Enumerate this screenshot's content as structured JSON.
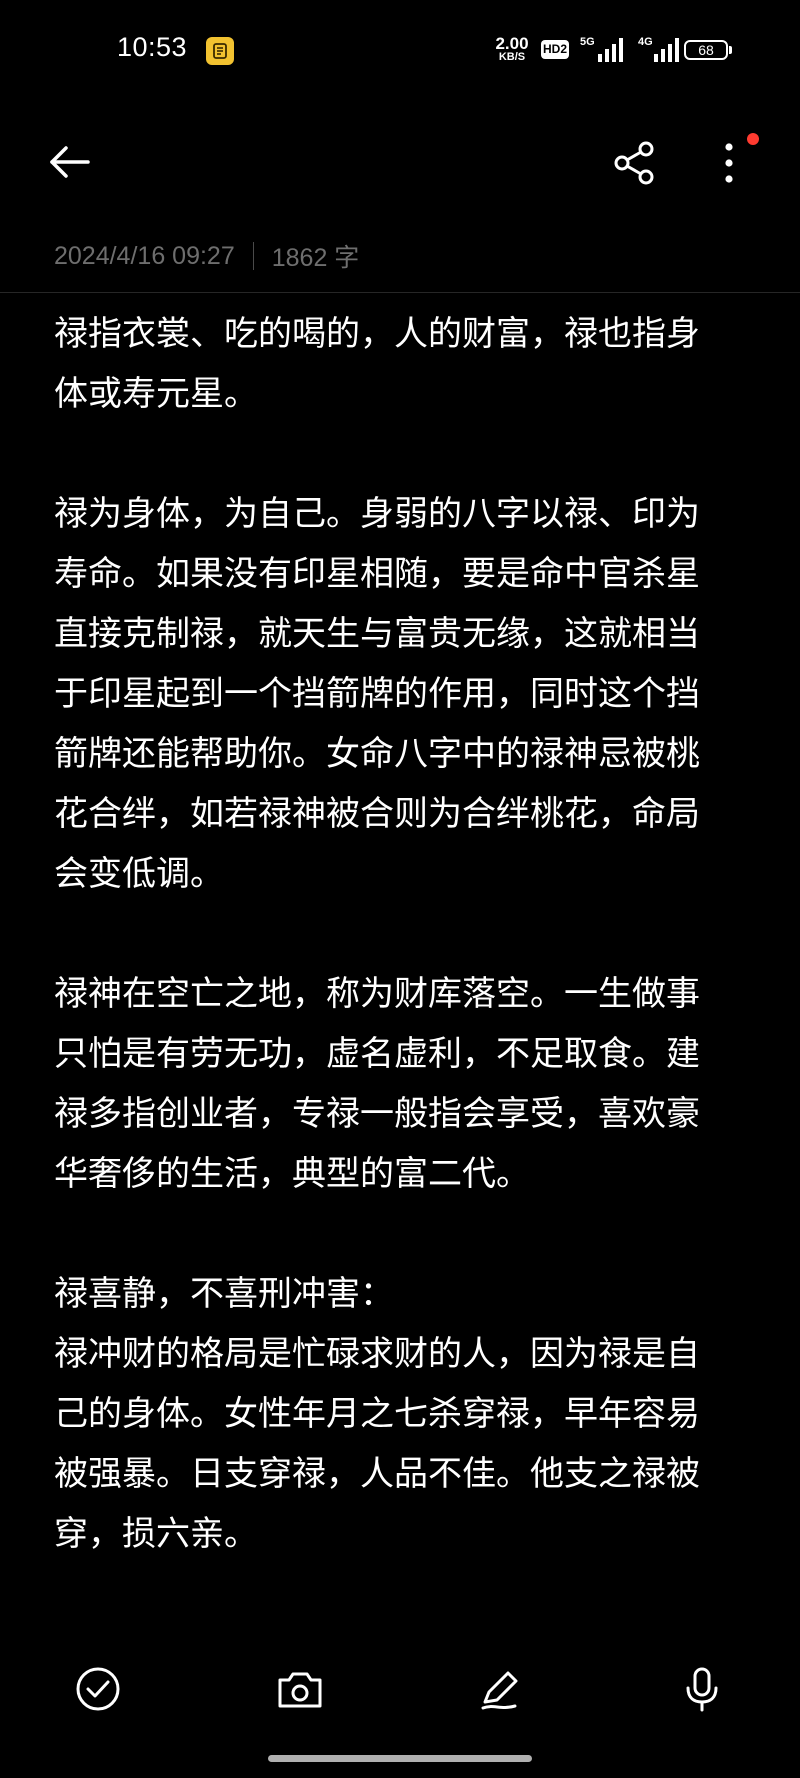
{
  "status_bar": {
    "time": "10:53",
    "net_speed_value": "2.00",
    "net_speed_unit": "KB/S",
    "hd_label": "HD2",
    "signal1_label": "5G",
    "signal2_label": "4G",
    "battery": "68"
  },
  "toolbar": {
    "back_icon": "arrow-left-icon",
    "share_icon": "share-icon",
    "more_icon": "more-vertical-icon"
  },
  "note": {
    "date": "2024/4/16 09:27",
    "char_count": "1862 字",
    "paragraphs": [
      "禄指衣裳、吃的喝的，人的财富，禄也指身\n体或寿元星。",
      "禄为身体，为自己。身弱的八字以禄、印为\n寿命。如果没有印星相随，要是命中官杀星\n直接克制禄，就天生与富贵无缘，这就相当\n于印星起到一个挡箭牌的作用，同时这个挡\n箭牌还能帮助你。女命八字中的禄神忌被桃\n花合绊，如若禄神被合则为合绊桃花，命局\n会变低调。",
      "禄神在空亡之地，称为财库落空。一生做事\n只怕是有劳无功，虚名虚利，不足取食。建\n禄多指创业者，专禄一般指会享受，喜欢豪\n华奢侈的生活，典型的富二代。",
      "禄喜静，不喜刑冲害：\n禄冲财的格局是忙碌求财的人，因为禄是自\n己的身体。女性年月之七杀穿禄，早年容易\n被强暴。日支穿禄，人品不佳。他支之禄被\n穿，损六亲。"
    ]
  },
  "bottom_toolbar": {
    "items": [
      "checkbox-icon",
      "camera-icon",
      "pen-icon",
      "microphone-icon"
    ]
  },
  "colors": {
    "background": "#000000",
    "text": "#ffffff",
    "meta_text": "#6e6e6e",
    "notification_dot": "#ff3b30"
  }
}
